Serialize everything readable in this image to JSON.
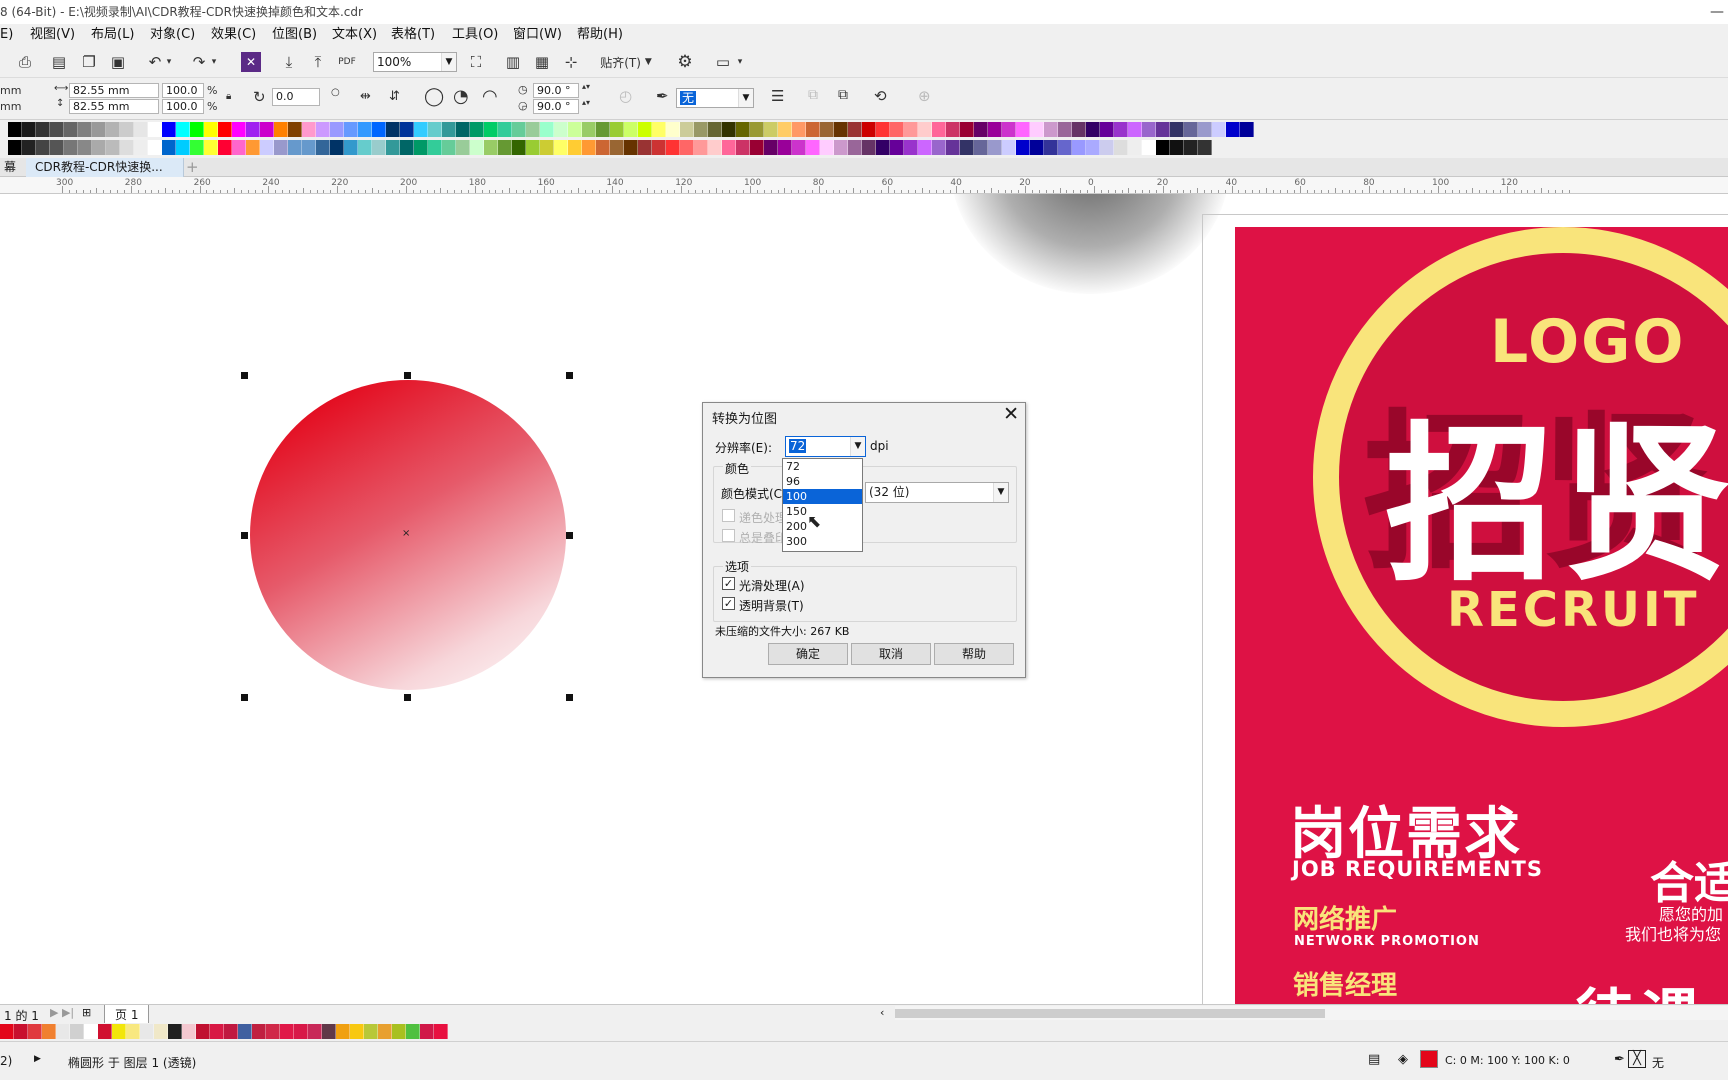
{
  "window": {
    "title": "8 (64-Bit) - E:\\视频录制\\AI\\CDR教程-CDR快速换掉颜色和文本.cdr"
  },
  "menu": {
    "items": [
      "E)",
      "视图(V)",
      "布局(L)",
      "对象(C)",
      "效果(C)",
      "位图(B)",
      "文本(X)",
      "表格(T)",
      "工具(O)",
      "窗口(W)",
      "帮助(H)"
    ]
  },
  "toolbar": {
    "zoom": "100%",
    "snap": "贴齐(T)",
    "pdf": "PDF"
  },
  "propbar": {
    "x_unit": "mm",
    "y_unit": "mm",
    "width": "82.55 mm",
    "height": "82.55 mm",
    "scale_w": "100.0",
    "scale_h": "100.0",
    "pct": "%",
    "rotation": "0.0",
    "angle_start": "90.0 °",
    "angle_end": "90.0 °",
    "outline": "无"
  },
  "tabs": {
    "first": "幕",
    "document": "CDR教程-CDR快速换...",
    "plus": "+"
  },
  "ruler": {
    "labels": [
      "300",
      "280",
      "260",
      "240",
      "220",
      "200",
      "180",
      "160",
      "140",
      "120",
      "100",
      "80",
      "60",
      "40",
      "20",
      "0",
      "20",
      "40",
      "60",
      "80",
      "100",
      "120"
    ]
  },
  "poster": {
    "logo": "LOGO",
    "big": "招贤",
    "recruit": "RECRUIT",
    "job_cn": "岗位需求",
    "job_en": "JOB REQUIREMENTS",
    "net_cn": "网络推广",
    "net_en": "NETWORK PROMOTION",
    "sales_cn": "销售经理",
    "right_cn": "合适",
    "right_line1": "愿您的加",
    "right_line2": "我们也将为您",
    "bottom_cn": "待遇"
  },
  "dialog": {
    "title": "转换为位图",
    "close": "✕",
    "resolution_label": "分辨率(E):",
    "resolution_value": "72",
    "dpi": "dpi",
    "color_group": "颜色",
    "color_mode_label": "颜色模式(C",
    "color_mode_value": "(32 位)",
    "dither_label": "递色处理",
    "overprint_label": "总是叠印",
    "options_group": "选项",
    "smooth_label": "光滑处理(A)",
    "transparent_label": "透明背景(T)",
    "filesize": "未压缩的文件大小: 267 KB",
    "ok": "确定",
    "cancel": "取消",
    "help": "帮助",
    "options": [
      "72",
      "96",
      "100",
      "150",
      "200",
      "300"
    ],
    "selected_option": "100",
    "smooth_checked": true,
    "transparent_checked": true
  },
  "pagebar": {
    "page_count": "1 的 1",
    "page_tab": "页 1"
  },
  "statusbar": {
    "left": "2)",
    "object_info": "椭圆形 于 图层 1 (透镜)",
    "fill_info": "C: 0 M: 100 Y: 100 K: 0",
    "outline_info": "无"
  },
  "colors": {
    "accent": "#0a64d8",
    "poster_bg": "#de1245",
    "poster_yellow": "#f9e47b",
    "circle_red": "#e3061a"
  },
  "icons": [
    "print-icon",
    "undo-icon",
    "redo-icon",
    "import-icon",
    "export-icon",
    "settings-icon",
    "zoom-fit-icon",
    "lock-icon",
    "close-icon"
  ]
}
